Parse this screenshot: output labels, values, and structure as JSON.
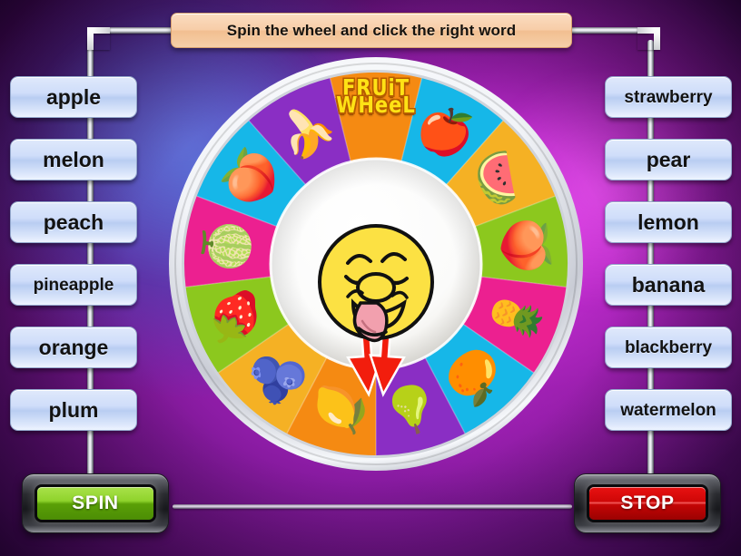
{
  "title_bar": {
    "text": "Spin the wheel and click the right word"
  },
  "left_words": [
    {
      "label": "apple",
      "size": "lg"
    },
    {
      "label": "melon",
      "size": "lg"
    },
    {
      "label": "peach",
      "size": "lg"
    },
    {
      "label": "pineapple",
      "size": "md"
    },
    {
      "label": "orange",
      "size": "lg"
    },
    {
      "label": "plum",
      "size": "lg"
    }
  ],
  "right_words": [
    {
      "label": "strawberry",
      "size": "md"
    },
    {
      "label": "pear",
      "size": "lg"
    },
    {
      "label": "lemon",
      "size": "lg"
    },
    {
      "label": "banana",
      "size": "lg"
    },
    {
      "label": "blackberry",
      "size": "md"
    },
    {
      "label": "watermelon",
      "size": "md"
    }
  ],
  "controls": {
    "spin_label": "SPIN",
    "stop_label": "STOP"
  },
  "wheel": {
    "logo_line1": "FRUiT",
    "logo_line2": "WHeeL",
    "center_face": "licking-smiley-face",
    "pointer": "double-red-arrow",
    "segments": [
      {
        "index": 0,
        "fruit": "logo",
        "color": "#f58a12",
        "icon": ""
      },
      {
        "index": 1,
        "fruit": "apple",
        "color": "#16b7e8",
        "icon": "🍎"
      },
      {
        "index": 2,
        "fruit": "watermelon",
        "color": "#f5b124",
        "icon": "🍉"
      },
      {
        "index": 3,
        "fruit": "peach",
        "color": "#8cc81e",
        "icon": "🍑"
      },
      {
        "index": 4,
        "fruit": "pineapple",
        "color": "#ec2090",
        "icon": "🍍"
      },
      {
        "index": 5,
        "fruit": "orange",
        "color": "#16b7e8",
        "icon": "🍊"
      },
      {
        "index": 6,
        "fruit": "pear",
        "color": "#8a2ec4",
        "icon": "🍐"
      },
      {
        "index": 7,
        "fruit": "lemon",
        "color": "#f58a12",
        "icon": "🍋"
      },
      {
        "index": 8,
        "fruit": "blackberry",
        "color": "#f5b124",
        "icon": "🫐"
      },
      {
        "index": 9,
        "fruit": "strawberry",
        "color": "#8cc81e",
        "icon": "🍓"
      },
      {
        "index": 10,
        "fruit": "melon",
        "color": "#ec2090",
        "icon": "🍈"
      },
      {
        "index": 11,
        "fruit": "plum",
        "color": "#16b7e8",
        "icon": "🍑"
      },
      {
        "index": 12,
        "fruit": "banana",
        "color": "#8a2ec4",
        "icon": "🍌"
      }
    ]
  },
  "colors": {
    "title_bg": "#f7cda8",
    "button_bg": "#cfddfa",
    "spin_green": "#8fd32c",
    "stop_red": "#cf0707",
    "background_purple": "#a726bb",
    "wheel_rim": "#e9ecf2"
  }
}
